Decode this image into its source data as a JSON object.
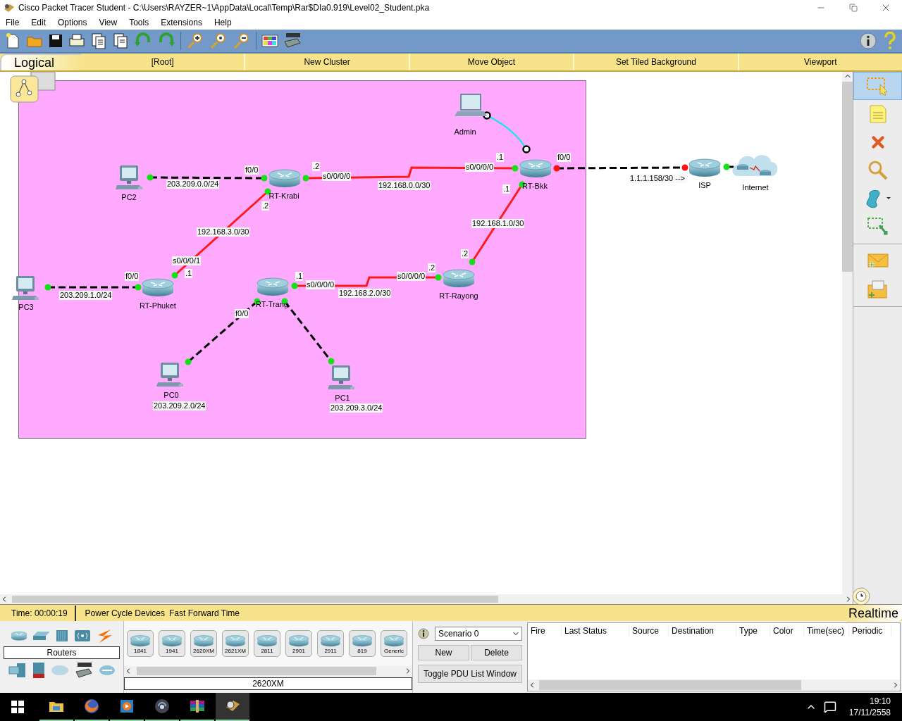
{
  "window": {
    "title": "Cisco Packet Tracer Student - C:\\Users\\RAYZER~1\\AppData\\Local\\Temp\\Rar$DIa0.919\\Level02_Student.pka"
  },
  "menu": [
    "File",
    "Edit",
    "Options",
    "View",
    "Tools",
    "Extensions",
    "Help"
  ],
  "workspace_bar": {
    "mode": "Logical",
    "items": [
      "[Root]",
      "New Cluster",
      "Move Object",
      "Set Tiled Background",
      "Viewport"
    ]
  },
  "devices": [
    {
      "name": "Admin",
      "kind": "laptop"
    },
    {
      "name": "PC2",
      "kind": "pc"
    },
    {
      "name": "RT-Krabi",
      "kind": "router"
    },
    {
      "name": "RT-Bkk",
      "kind": "router"
    },
    {
      "name": "ISP",
      "kind": "router"
    },
    {
      "name": "Internet",
      "kind": "cloud"
    },
    {
      "name": "PC3",
      "kind": "pc"
    },
    {
      "name": "RT-Phuket",
      "kind": "router"
    },
    {
      "name": "RT-Trang",
      "kind": "router"
    },
    {
      "name": "RT-Rayong",
      "kind": "router"
    },
    {
      "name": "PC0",
      "kind": "pc"
    },
    {
      "name": "PC1",
      "kind": "pc"
    }
  ],
  "links": [
    {
      "kind": "copper",
      "a_up": true,
      "b_up": true
    },
    {
      "kind": "serial",
      "a_up": true,
      "b_up": true
    },
    {
      "kind": "copper",
      "a_up": false,
      "b_up": false
    },
    {
      "kind": "copper",
      "a_up": true
    },
    {
      "kind": "console"
    },
    {
      "kind": "serial",
      "a_up": true,
      "b_up": true
    },
    {
      "kind": "serial",
      "a_up": true,
      "b_up": true
    },
    {
      "kind": "copper",
      "a_up": true,
      "b_up": true
    },
    {
      "kind": "serial",
      "a_up": true,
      "b_up": true
    },
    {
      "kind": "copper",
      "a_up": true,
      "b_up": true
    },
    {
      "kind": "copper",
      "a_up": true,
      "b_up": true
    }
  ],
  "labels": [
    "f0/0",
    ".2",
    "s0/0/0/0",
    "203.209.0.0/24",
    "192.168.0.0/30",
    ".1",
    "s0/0/0/0",
    "f0/0",
    ".1",
    "192.168.1.0/30",
    ".2",
    "192.168.3.0/30",
    "s0/0/0/1",
    ".1",
    "f0/0",
    "203.209.1.0/24",
    ".1",
    "s0/0/0/0",
    "192.168.2.0/30",
    "s0/0/0/0",
    ".2",
    ".2",
    "f0/0",
    "203.209.2.0/24",
    "203.209.3.0/24",
    "1.1.1.158/30 -->"
  ],
  "tools": [
    {
      "selected": true
    },
    {
      "selected": false
    },
    {
      "selected": false
    },
    {
      "selected": false
    },
    {
      "selected": false
    },
    {
      "selected": false
    },
    {
      "selected": false
    },
    {
      "selected": false
    }
  ],
  "time_bar": {
    "time": "Time: 00:00:19",
    "actions": [
      "Power Cycle Devices",
      "Fast Forward Time"
    ],
    "mode": "Realtime"
  },
  "device_panel": {
    "category": "Routers",
    "models": [
      "1841",
      "1941",
      "2620XM",
      "2621XM",
      "2811",
      "2901",
      "2911",
      "819",
      "Generic"
    ],
    "current_model": "2620XM"
  },
  "scenario": {
    "value": "Scenario 0",
    "buttons": [
      "New",
      "Delete"
    ],
    "toggle": "Toggle PDU List Window"
  },
  "pdu_table": {
    "columns": [
      "Fire",
      "Last Status",
      "Source",
      "Destination",
      "Type",
      "Color",
      "Time(sec)",
      "Periodic"
    ]
  },
  "taskbar": {
    "time": "19:10",
    "date": "17/11/2558"
  }
}
